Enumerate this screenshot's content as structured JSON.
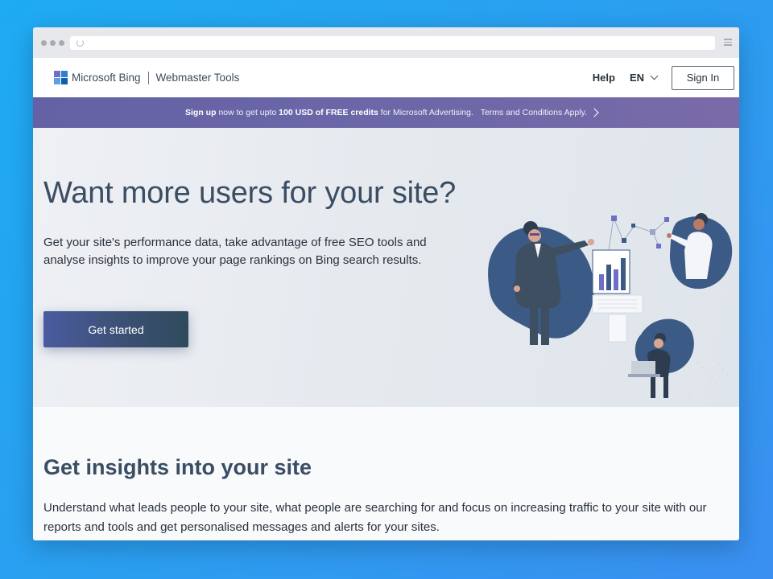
{
  "site": {
    "brand": "Microsoft Bing",
    "product": "Webmaster Tools",
    "logo_colors": [
      "#6f6fc8",
      "#2c7fd3",
      "#5aa0e6",
      "#0f5ea8"
    ]
  },
  "nav": {
    "help": "Help",
    "language": "EN",
    "sign_in": "Sign In"
  },
  "promo": {
    "signup": "Sign up",
    "text1": "now to get upto",
    "amount": "100 USD of FREE credits",
    "text2": "for Microsoft Advertising.",
    "terms": "Terms and Conditions Apply."
  },
  "hero": {
    "title": "Want more users for your site?",
    "description": "Get your site's performance data, take advantage of free SEO tools and analyse insights to improve your page rankings on Bing search results.",
    "cta": "Get started"
  },
  "insights": {
    "title": "Get insights into your site",
    "description": "Understand what leads people to your site, what people are searching for and focus on increasing traffic to your site with our reports and tools and get personalised messages and alerts for your sites."
  },
  "icons": [
    "reload-icon",
    "menu-icon",
    "microsoft-logo",
    "chevron-down-icon",
    "chevron-right-icon"
  ],
  "colors": {
    "background": "#1eabf3",
    "heading": "#3a4d63",
    "promo_bar": "#6461a5",
    "cta_start": "#4b5ba0",
    "cta_end": "#2f4a5c"
  }
}
